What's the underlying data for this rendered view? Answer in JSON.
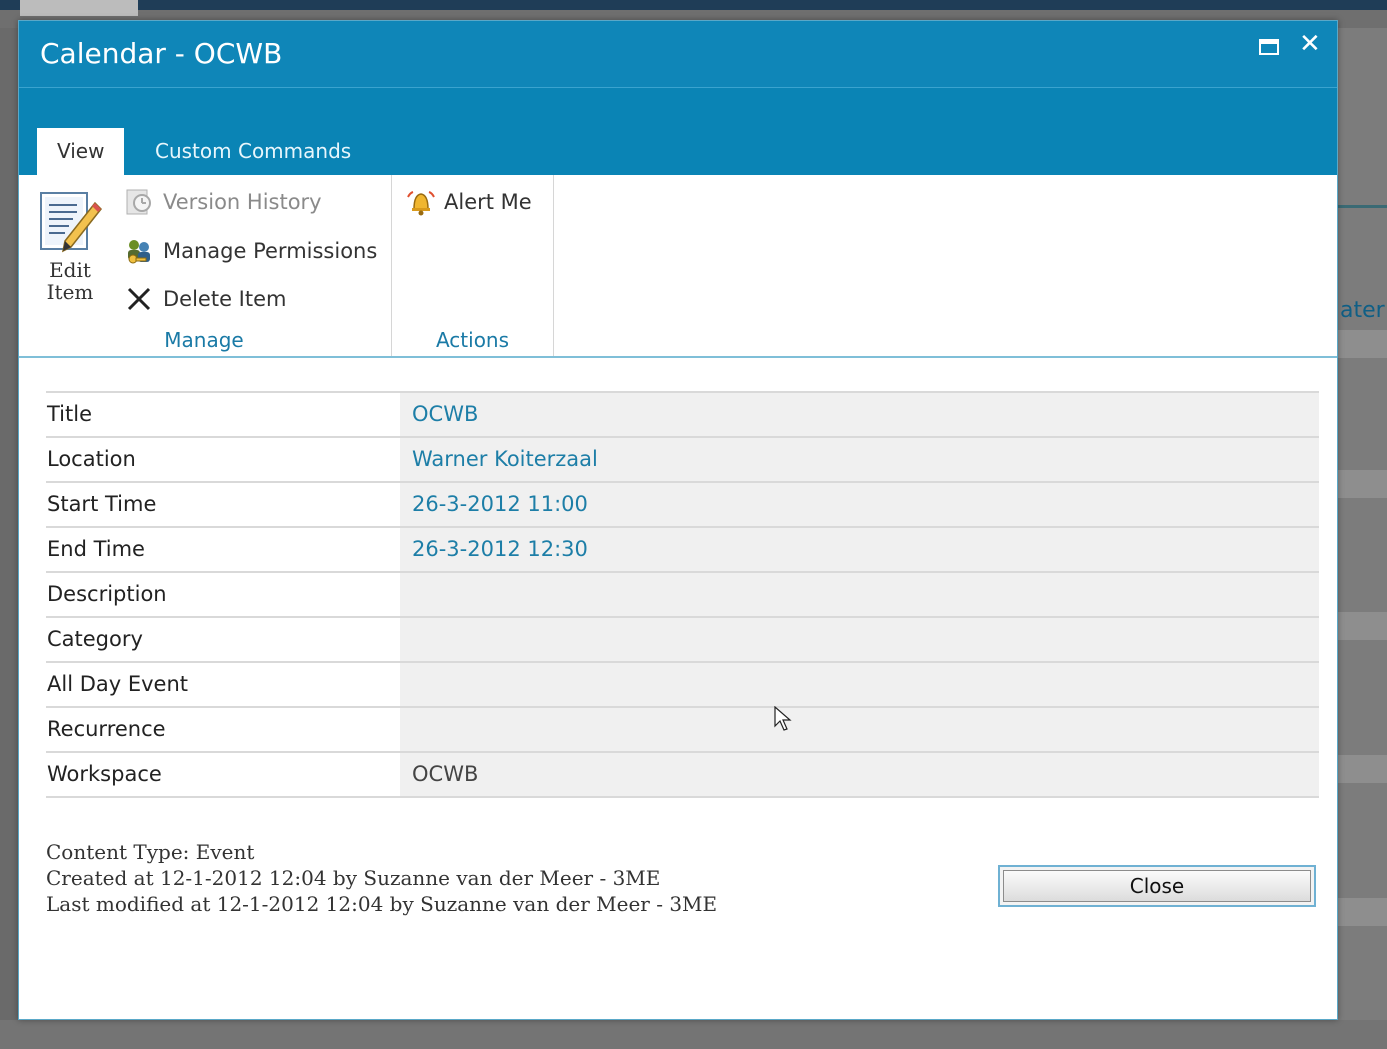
{
  "dialog": {
    "title": "Calendar - OCWB"
  },
  "background": {
    "right_partial_text": "ater"
  },
  "tabs": [
    {
      "label": "View",
      "active": true
    },
    {
      "label": "Custom Commands",
      "active": false
    }
  ],
  "ribbon": {
    "manage": {
      "group_label": "Manage",
      "edit_item_line1": "Edit",
      "edit_item_line2": "Item",
      "version_history": "Version History",
      "manage_permissions": "Manage Permissions",
      "delete_item": "Delete Item"
    },
    "actions": {
      "group_label": "Actions",
      "alert_me": "Alert Me"
    }
  },
  "properties": [
    {
      "name": "Title",
      "value": "OCWB",
      "link": true
    },
    {
      "name": "Location",
      "value": "Warner Koiterzaal",
      "link": true
    },
    {
      "name": "Start Time",
      "value": "26-3-2012 11:00",
      "link": true
    },
    {
      "name": "End Time",
      "value": "26-3-2012 12:30",
      "link": true
    },
    {
      "name": "Description",
      "value": "",
      "link": false
    },
    {
      "name": "Category",
      "value": "",
      "link": false
    },
    {
      "name": "All Day Event",
      "value": "",
      "link": false
    },
    {
      "name": "Recurrence",
      "value": "",
      "link": false
    },
    {
      "name": "Workspace",
      "value": "OCWB",
      "link": false
    }
  ],
  "meta": {
    "content_type": "Content Type: Event",
    "created": "Created at 12-1-2012 12:04 by Suzanne van der Meer - 3ME",
    "modified": "Last modified at 12-1-2012 12:04 by Suzanne van der Meer - 3ME"
  },
  "buttons": {
    "close": "Close"
  },
  "colors": {
    "titlebar": "#0f86b8",
    "link": "#1d7ea7",
    "group_label": "#1a7aa6"
  }
}
